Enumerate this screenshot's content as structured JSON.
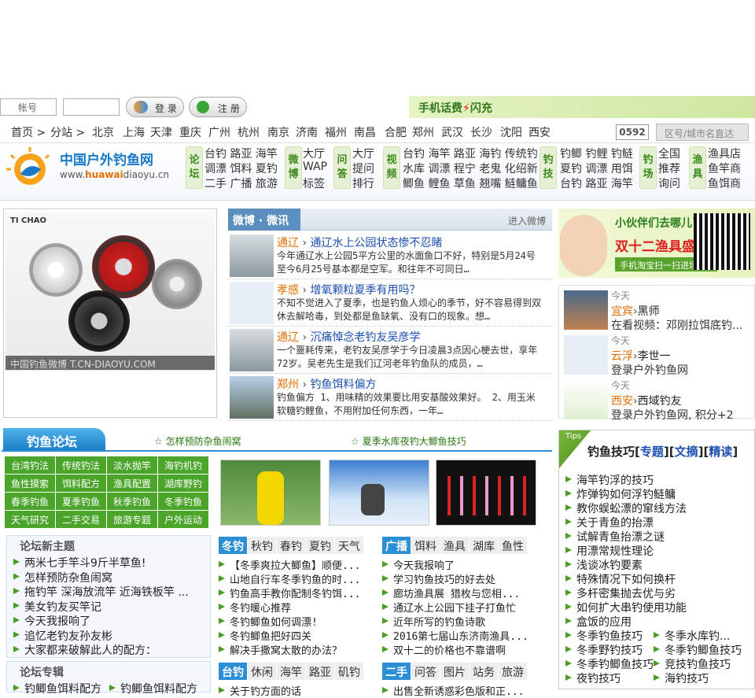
{
  "login": {
    "username_placeholder": "帐号",
    "login_btn": "登 录",
    "register_btn": "注 册",
    "promo": "手机话费",
    "promo2": "闪充"
  },
  "cities": [
    "首页 >",
    "分站 >",
    "北京",
    "上海",
    "天津",
    "重庆",
    "广州",
    "杭州",
    "南京",
    "济南",
    "福州",
    "南昌",
    "合肥",
    "郑州",
    "武汉",
    "长沙",
    "沈阳",
    "西安"
  ],
  "area_code": "0592",
  "city_search_placeholder": "区号/城市名直达",
  "logo": {
    "name": "中国户外钓鱼网",
    "url_a": "www.",
    "url_b": "huawai",
    "url_c": "diaoyu",
    "url_d": ".cn"
  },
  "nav": {
    "luntan": {
      "label": "论坛",
      "rows": [
        "台钓 路亚 海竿",
        "调漂 饵料 夏钓",
        "二手 广播 旅游"
      ]
    },
    "weibo": {
      "label": "微博",
      "rows": [
        "大厅",
        "WAP",
        "标签"
      ]
    },
    "wenda": {
      "label": "问答",
      "rows": [
        "大厅",
        "提问",
        "排行"
      ]
    },
    "shipin": {
      "label": "视频",
      "rows": [
        "台钓 海竿 路亚 海钓 传统钓",
        "水库 调漂 程宁 老鬼 化绍新",
        "鲫鱼 鲤鱼 草鱼 翘嘴 鲢鳙鱼"
      ]
    },
    "diaoji": {
      "label": "钓技",
      "rows": [
        "钓鲫 钓鲤 钓鲢",
        "夏钓 调漂 用饵",
        "台钓 路亚 海竿"
      ]
    },
    "diaochang": {
      "label": "钓场",
      "rows": [
        "全国",
        "推荐",
        "询问"
      ]
    },
    "yuju": {
      "label": "渔具",
      "rows": [
        "渔具店",
        "鱼竿商",
        "鱼饵商"
      ]
    }
  },
  "slideshow": {
    "brand": "TI CHAO",
    "caption": "中国钓鱼微博 T.CN-DIAOYU.COM"
  },
  "weibo": {
    "title": "微博 · 微讯",
    "more": "进入微博",
    "items": [
      {
        "city": "通辽",
        "sep": " › ",
        "title": "通辽水上公园状态惨不忍睹",
        "desc": "今年通辽水上公园5平方公里的水面鱼口不好，特别是5月24号至今6月25号基本都是空军。和往年不可同日…"
      },
      {
        "city": "孝感",
        "sep": " › ",
        "title": "增氧颗粒夏季有用吗？",
        "desc": "不知不觉进入了夏季，也是钓鱼人烦心的季节，好不容易得到双休去解哈毒，到处都是鱼缺氧、没有口的现象。想…"
      },
      {
        "city": "通辽",
        "sep": " › ",
        "title": "沉痛悼念老钓友吴彦学",
        "desc": "一个噩耗传来，老钓友吴彦学于今日凌晨3点因心梗去世，享年72岁。吴老先生是我们辽河老年钓鱼队的成员，…"
      },
      {
        "city": "郑州",
        "sep": " › ",
        "title": "钓鱼饵料偏方",
        "desc": "钓鱼偏方 1、用味精的效果要比用安基酸效果好。 2、用玉米软糖钓鲤鱼，不用附加任何东西，一年…"
      }
    ]
  },
  "ad": {
    "line1": "小伙伴们去哪儿了？",
    "line2": "双十二渔具盛典",
    "line3": "手机淘宝扫一扫进场"
  },
  "activity": [
    {
      "date": "今天",
      "city": "宜宾",
      "sep": "›",
      "user": "黑师",
      "action": "在看视频：邓刚拉饵底钓..."
    },
    {
      "date": "今天",
      "city": "云浮",
      "sep": "›",
      "user": "李世一",
      "action": "登录户外钓鱼网"
    },
    {
      "date": "今天",
      "city": "西安",
      "sep": "›",
      "user": "西域钓友",
      "action": "登录户外钓鱼网, 积分+2"
    }
  ],
  "forum": {
    "title": "钓鱼论坛",
    "top_links": [
      "怎样预防杂鱼闹窝",
      "夏季水库夜钓大鲫鱼技巧"
    ],
    "grid": [
      "台湾钓法",
      "传统钓法",
      "淡水抛竿",
      "海钓机钓",
      "鱼性摸索",
      "饵料配方",
      "渔具配置",
      "湖库野钓",
      "春季钓鱼",
      "夏季钓鱼",
      "秋季钓鱼",
      "冬季钓鱼",
      "天气研究",
      "二手交易",
      "旅游专题",
      "户外运动"
    ],
    "new_title": "论坛新主题",
    "new_items": [
      "两米七手竿斗9斤半草鱼!",
      "怎样预防杂鱼闹窝",
      "拖钓竿 深海放流竿 近海铁板竿 ...",
      "美女钓友买竿记",
      "今天我报响了",
      "追忆老钓友孙友彬",
      "大家都来破解此人的配方："
    ],
    "special_title": "论坛专辑",
    "special_items": [
      "钓鲫鱼饵料配方",
      "钓鲫鱼饵料配方"
    ],
    "tabs1": [
      "冬钓",
      "秋钓",
      "春钓",
      "夏钓",
      "天气"
    ],
    "list1": [
      "【冬季爽拉大鲫鱼】顺便...",
      "山地自行车冬季钓鱼的时...",
      "钓鱼高手教你配制冬钓饵...",
      "冬钓暖心推荐",
      "冬钓鲫鱼如何调漂!",
      "冬钓鲫鱼把好四关",
      "解决手撒窝太散的办法？"
    ],
    "tabs2": [
      "广播",
      "饵料",
      "渔具",
      "湖库",
      "鱼性"
    ],
    "list2": [
      "今天我报响了",
      "学习钓鱼技巧的好去处",
      "廊坊渔具展 猎枚与您相...",
      "通辽水上公园下挂子打鱼忙",
      "近年所写的钓鱼诗歌",
      "2016第七届山东济南渔具...",
      "双十二的价格也不靠谱啊"
    ],
    "tabs3": [
      "台钓",
      "休闲",
      "海竿",
      "路亚",
      "矶钓"
    ],
    "tabs4": [
      "二手",
      "问答",
      "图片",
      "站务",
      "旅游"
    ],
    "list3": [
      "关于钓方面的话"
    ],
    "list4": [
      "出售全新诱惑彩色版和正..."
    ]
  },
  "tips": {
    "tag": "Tips",
    "title_a": "钓鱼技巧[",
    "title_b": "专题",
    "title_c": "][",
    "title_d": "文摘",
    "title_e": "][",
    "title_f": "精读",
    "title_g": "]",
    "items": [
      "海竿钓浮的技巧",
      "炸弹钩如何浮钓鲢鳙",
      "教你蜈蚣漂的窜线方法",
      "关于青鱼的抬漂",
      "试解青鱼抬漂之谜",
      "用漂常规性理论",
      "浅谈冰钓要素",
      "特殊情况下如何换杆",
      "多杆密集抛去优与劣",
      "如何扩大串钓使用功能",
      "盒饭的应用"
    ],
    "pairs": [
      [
        "冬季钓鱼技巧",
        "冬季水库钓..."
      ],
      [
        "冬季野钓技巧",
        "冬季钓鲫鱼技巧"
      ],
      [
        "冬季钓鲫鱼技巧",
        "竞技钓鱼技巧"
      ],
      [
        "夜钓技巧",
        "海钓技巧"
      ]
    ]
  }
}
